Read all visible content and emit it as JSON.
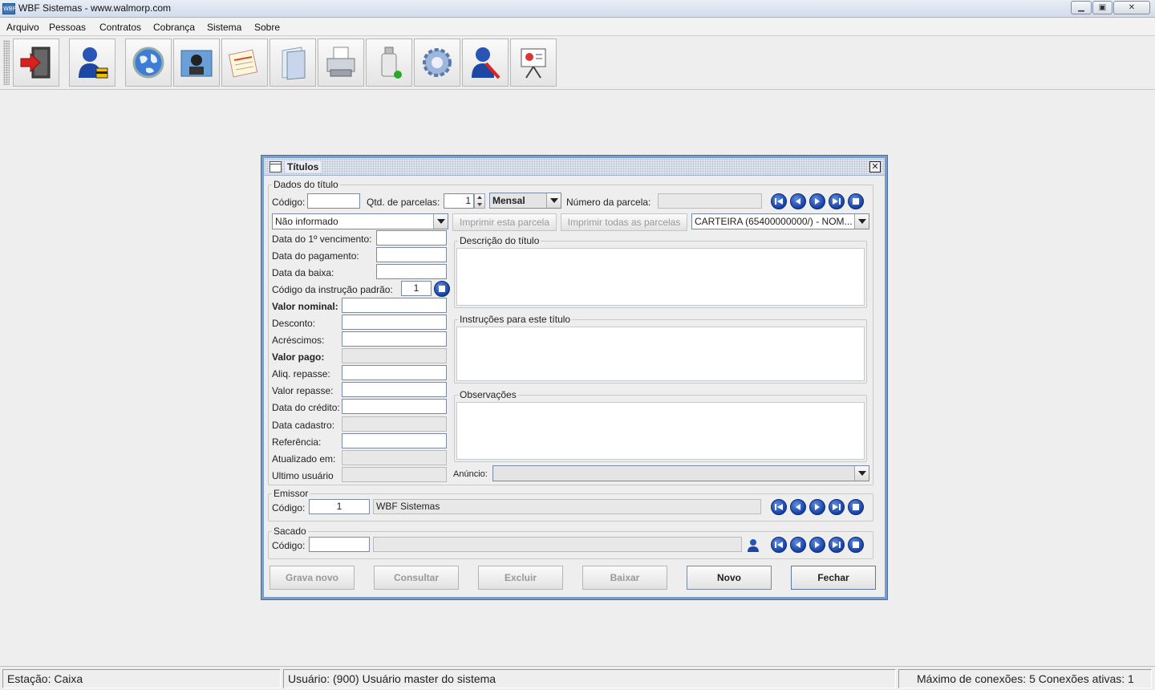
{
  "window": {
    "title": "WBF Sistemas - www.walmorp.com",
    "icon_text": "WBF"
  },
  "menu": [
    "Arquivo",
    "Pessoas",
    "Contratos",
    "Cobrança",
    "Sistema",
    "Sobre"
  ],
  "toolbar": {
    "buttons": [
      "exit-icon",
      "user-lock-icon",
      "globe-icon",
      "contact-card-icon",
      "notes-icon",
      "folders-icon",
      "printer-icon",
      "usb-drive-icon",
      "settings-gear-icon",
      "user-tools-icon",
      "presentation-icon"
    ]
  },
  "frame": {
    "title": "Títulos",
    "close_glyph": "✕",
    "dados": {
      "group_label": "Dados do título",
      "codigo_label": "Código:",
      "codigo_value": "",
      "qtd_label": "Qtd. de parcelas:",
      "qtd_value": "1",
      "periodo_value": "Mensal",
      "numero_parcela_label": "Número da parcela:",
      "numero_parcela_value": "",
      "situacao_value": "Não informado",
      "imprimir_esta": "Imprimir esta parcela",
      "imprimir_todas": "Imprimir todas as parcelas",
      "carteira_value": "CARTEIRA (65400000000/) - NOM...",
      "fields": [
        {
          "label": "Data do 1º vencimento:",
          "value": "",
          "bold": false,
          "readonly": false
        },
        {
          "label": "Data do pagamento:",
          "value": "",
          "bold": false,
          "readonly": false
        },
        {
          "label": "Data da baixa:",
          "value": "",
          "bold": false,
          "readonly": false
        },
        {
          "label": "Código da instrução padrão:",
          "value": "1",
          "bold": false,
          "readonly": false
        },
        {
          "label": "Valor nominal:",
          "value": "",
          "bold": true,
          "readonly": false
        },
        {
          "label": "Desconto:",
          "value": "",
          "bold": false,
          "readonly": false
        },
        {
          "label": "Acréscimos:",
          "value": "",
          "bold": false,
          "readonly": false
        },
        {
          "label": "Valor pago:",
          "value": "",
          "bold": true,
          "readonly": true
        },
        {
          "label": "Aliq. repasse:",
          "value": "",
          "bold": false,
          "readonly": false
        },
        {
          "label": "Valor repasse:",
          "value": "",
          "bold": false,
          "readonly": false
        },
        {
          "label": "Data do crédito:",
          "value": "",
          "bold": false,
          "readonly": false
        },
        {
          "label": "Data cadastro:",
          "value": "",
          "bold": false,
          "readonly": true
        },
        {
          "label": "Referência:",
          "value": "",
          "bold": false,
          "readonly": false
        },
        {
          "label": "Atualizado em:",
          "value": "",
          "bold": false,
          "readonly": true
        },
        {
          "label": "Ultimo usuário",
          "value": "",
          "bold": false,
          "readonly": true
        }
      ],
      "descricao_label": "Descrição do título",
      "instrucoes_label": "Instruções para este título",
      "observacoes_label": "Observações",
      "anuncio_label": "Anúncio:",
      "anuncio_value": ""
    },
    "emissor": {
      "group_label": "Emissor",
      "codigo_label": "Código:",
      "codigo_value": "1",
      "nome_value": "WBF Sistemas"
    },
    "sacado": {
      "group_label": "Sacado",
      "codigo_label": "Código:",
      "codigo_value": "",
      "nome_value": ""
    },
    "buttons": {
      "grava_novo": "Grava novo",
      "consultar": "Consultar",
      "excluir": "Excluir",
      "baixar": "Baixar",
      "novo": "Novo",
      "fechar": "Fechar"
    }
  },
  "status": {
    "estacao": "Estação: Caixa",
    "usuario": "Usuário: (900) Usuário master do sistema",
    "conexoes": "Máximo de conexões: 5 Conexões ativas: 1"
  },
  "colors": {
    "frame_border": "#7a9cc9",
    "nav_button": "#1e4fb8",
    "background": "#eeeeee"
  }
}
